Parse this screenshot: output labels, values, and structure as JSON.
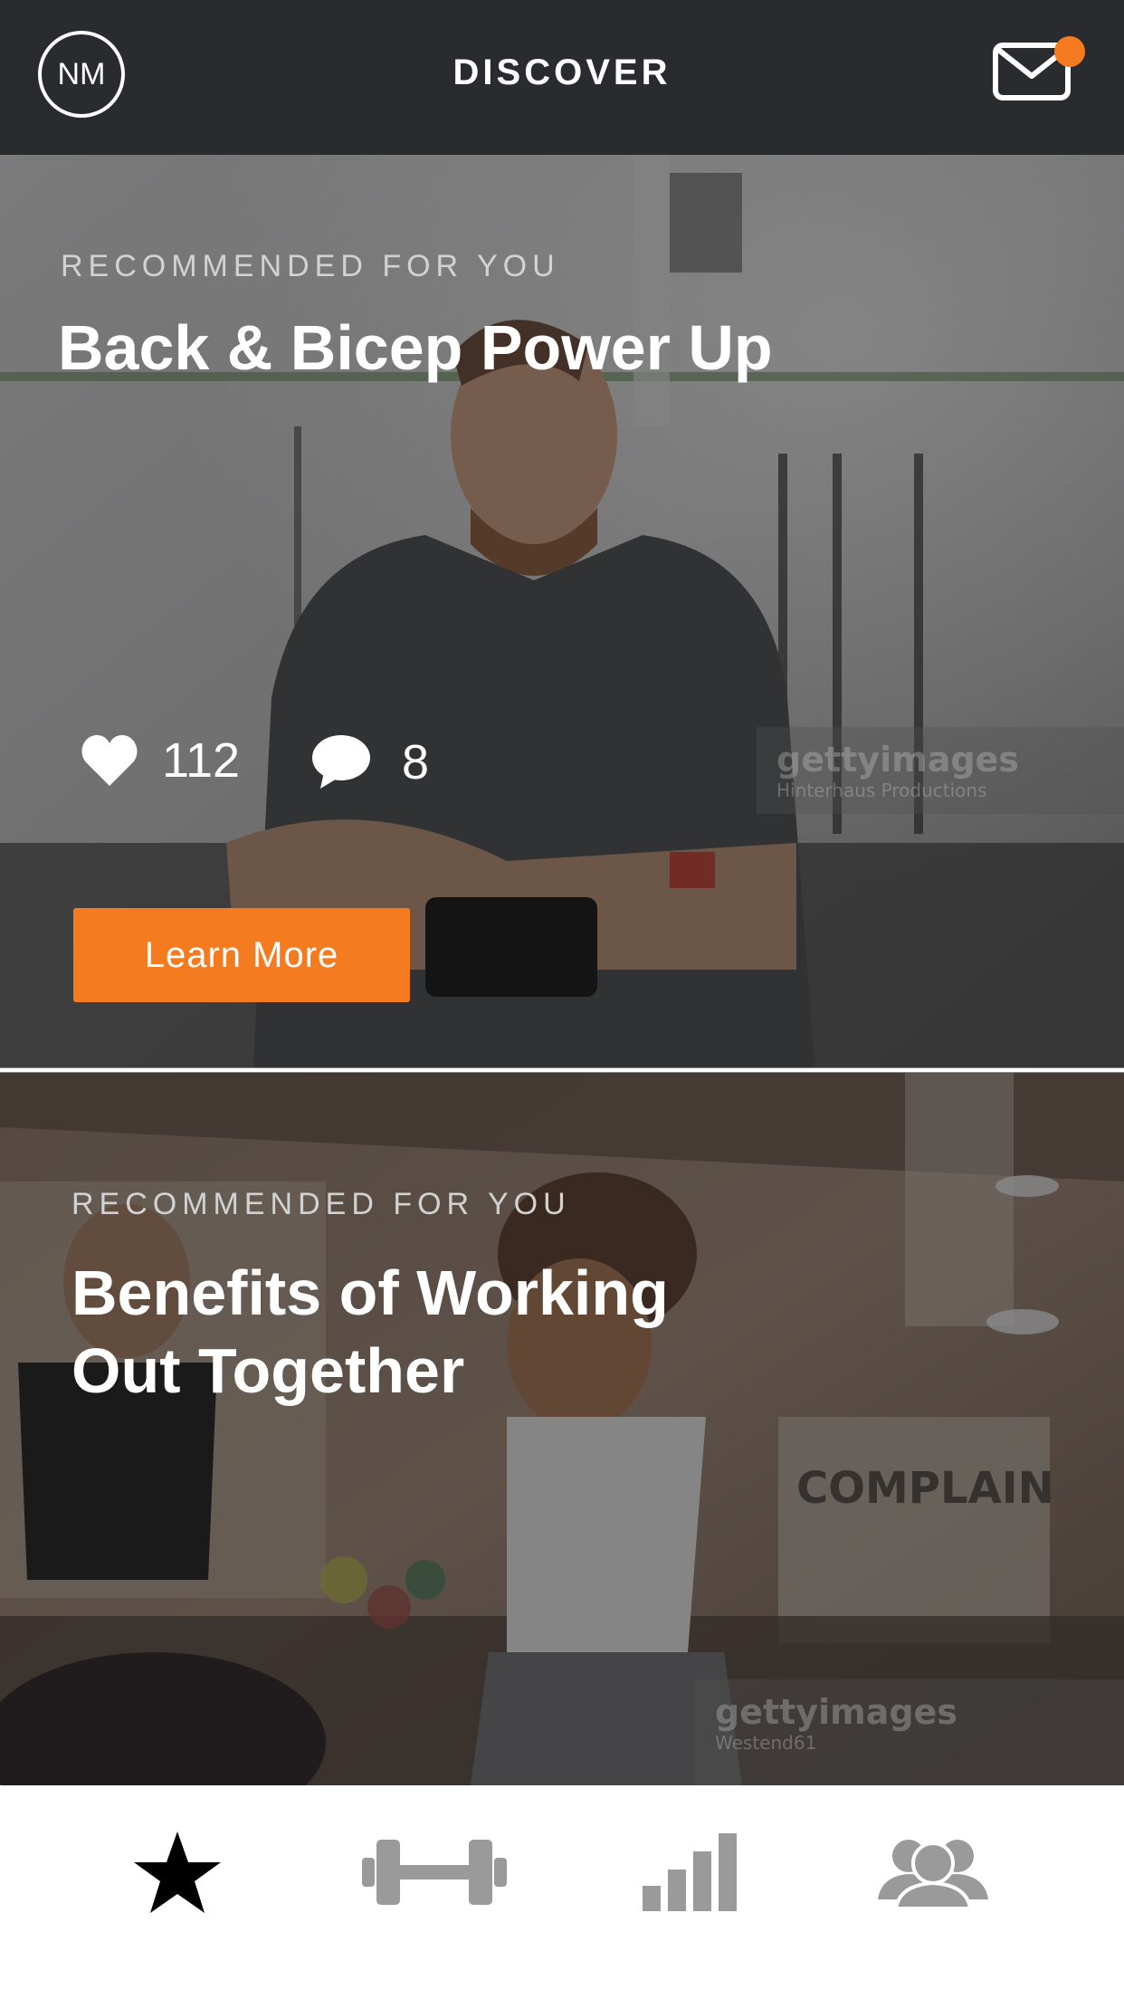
{
  "header": {
    "avatar_initials": "NM",
    "title": "DISCOVER",
    "has_notification": true
  },
  "cards": [
    {
      "eyebrow": "RECOMMENDED FOR YOU",
      "title": "Back & Bicep Power Up",
      "likes": "112",
      "comments": "8",
      "button_label": "Learn More",
      "watermark_brand": "gettyimages",
      "watermark_credit": "Hinterhaus Productions"
    },
    {
      "eyebrow": "RECOMMENDED FOR YOU",
      "title_line1": "Benefits of Working",
      "title_line2": "Out Together",
      "watermark_brand": "gettyimages",
      "watermark_credit": "Westend61"
    }
  ],
  "tabbar": {
    "tabs": [
      {
        "icon": "star-icon",
        "active": true
      },
      {
        "icon": "dumbbell-icon",
        "active": false
      },
      {
        "icon": "bar-chart-icon",
        "active": false
      },
      {
        "icon": "group-icon",
        "active": false
      }
    ]
  },
  "colors": {
    "header_bg": "#2a2b2f",
    "accent": "#f47b20",
    "tab_active": "#000000",
    "tab_inactive": "#9a9a9a"
  }
}
